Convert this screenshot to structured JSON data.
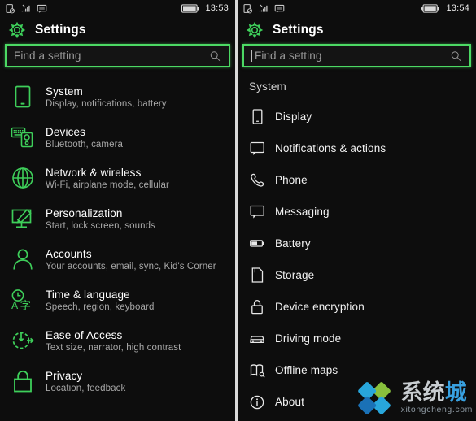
{
  "theme": {
    "background": "#0d0d0d",
    "accent_green": "#4cd964",
    "text_primary": "#ffffff",
    "text_secondary": "#a8a8a8",
    "divider": "#d9d9d9"
  },
  "left_panel": {
    "statusbar": {
      "icons": [
        "no-sim-icon",
        "wifi-no-connection-icon",
        "message-icon"
      ],
      "battery_icon": "battery-icon",
      "time": "13:53"
    },
    "header": {
      "icon": "settings-gear-icon",
      "title": "Settings"
    },
    "search": {
      "placeholder": "Find a setting",
      "value": "",
      "icon": "search-icon",
      "caret": false
    },
    "items": [
      {
        "icon": "phone-system-icon",
        "title": "System",
        "subtitle": "Display, notifications, battery"
      },
      {
        "icon": "devices-icon",
        "title": "Devices",
        "subtitle": "Bluetooth, camera"
      },
      {
        "icon": "globe-network-icon",
        "title": "Network & wireless",
        "subtitle": "Wi-Fi, airplane mode, cellular"
      },
      {
        "icon": "personalization-icon",
        "title": "Personalization",
        "subtitle": "Start, lock screen, sounds"
      },
      {
        "icon": "accounts-person-icon",
        "title": "Accounts",
        "subtitle": "Your accounts, email, sync, Kid's Corner"
      },
      {
        "icon": "time-language-icon",
        "title": "Time & language",
        "subtitle": "Speech, region, keyboard"
      },
      {
        "icon": "ease-of-access-icon",
        "title": "Ease of Access",
        "subtitle": "Text size, narrator, high contrast"
      },
      {
        "icon": "privacy-lock-icon",
        "title": "Privacy",
        "subtitle": "Location, feedback"
      }
    ]
  },
  "right_panel": {
    "statusbar": {
      "icons": [
        "no-sim-icon",
        "wifi-no-connection-icon",
        "message-icon"
      ],
      "battery_icon": "battery-charging-icon",
      "time": "13:54"
    },
    "header": {
      "icon": "settings-gear-icon",
      "title": "Settings"
    },
    "search": {
      "placeholder": "Find a setting",
      "value": "",
      "icon": "search-icon",
      "caret": true
    },
    "group_title": "System",
    "items": [
      {
        "icon": "display-icon",
        "label": "Display"
      },
      {
        "icon": "notifications-icon",
        "label": "Notifications & actions"
      },
      {
        "icon": "phone-handset-icon",
        "label": "Phone"
      },
      {
        "icon": "messaging-icon",
        "label": "Messaging"
      },
      {
        "icon": "battery-icon",
        "label": "Battery"
      },
      {
        "icon": "storage-icon",
        "label": "Storage"
      },
      {
        "icon": "device-encryption-icon",
        "label": "Device encryption"
      },
      {
        "icon": "driving-mode-icon",
        "label": "Driving mode"
      },
      {
        "icon": "offline-maps-icon",
        "label": "Offline maps"
      },
      {
        "icon": "about-info-icon",
        "label": "About"
      }
    ]
  },
  "watermark": {
    "logo_icon": "diamond-logo-icon",
    "cn_text_1": "系统",
    "cn_text_2": "城",
    "url": "xitongcheng.com",
    "colors": {
      "green": "#8cc63f",
      "cyan": "#29abe2",
      "blue": "#1b75bc",
      "accent": "#3aa6e8"
    }
  }
}
